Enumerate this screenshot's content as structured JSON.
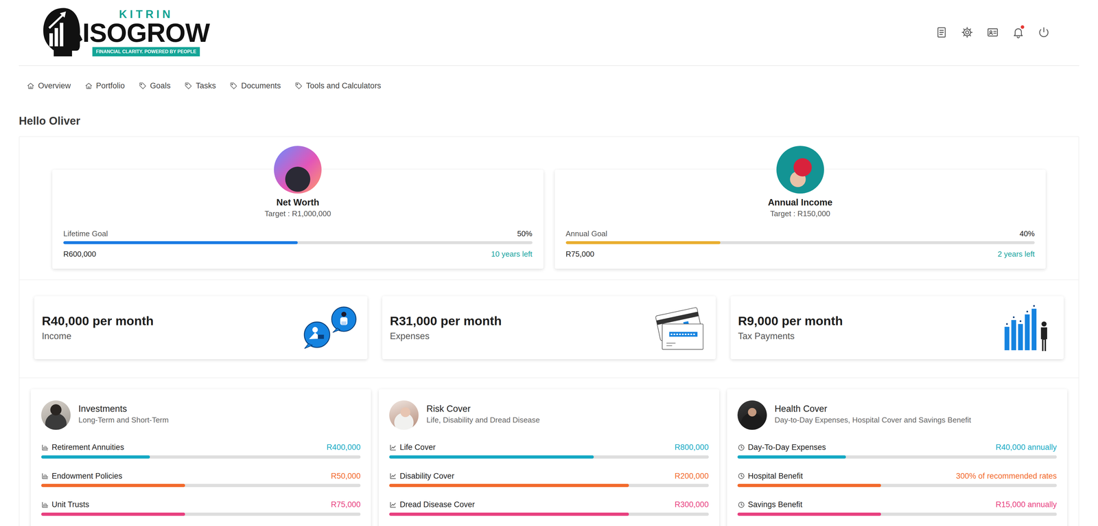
{
  "header": {
    "brand": "KITRIN",
    "name": "ISOGROW",
    "tagline": "FINANCIAL CLARITY. POWERED BY PEOPLE",
    "notifications_unread": true
  },
  "nav": [
    {
      "label": "Overview",
      "kind": "home"
    },
    {
      "label": "Portfolio",
      "kind": "home"
    },
    {
      "label": "Goals",
      "kind": "tag"
    },
    {
      "label": "Tasks",
      "kind": "tag"
    },
    {
      "label": "Documents",
      "kind": "tag"
    },
    {
      "label": "Tools and Calculators",
      "kind": "tag"
    }
  ],
  "greeting": "Hello Oliver",
  "goals": [
    {
      "title": "Net Worth",
      "target": "Target : R1,000,000",
      "goal_label": "Lifetime Goal",
      "percent": "50%",
      "level": 0.5,
      "value": "R600,000",
      "remaining": "10 years left",
      "color": "#1a7be3"
    },
    {
      "title": "Annual Income",
      "target": "Target : R150,000",
      "goal_label": "Annual Goal",
      "percent": "40%",
      "level": 0.33,
      "value": "R75,000",
      "remaining": "2 years left",
      "color": "#e9ae2f"
    }
  ],
  "summary": [
    {
      "amount": "R40,000 per month",
      "label": "Income",
      "kind": "people"
    },
    {
      "amount": "R31,000 per month",
      "label": "Expenses",
      "kind": "cards"
    },
    {
      "amount": "R9,000 per month",
      "label": "Tax Payments",
      "kind": "chart"
    }
  ],
  "categories": [
    {
      "title": "Investments",
      "subtitle": "Long-Term and Short-Term",
      "kind": "bars",
      "rows": [
        {
          "label": "Retirement Annuities",
          "value": "R400,000",
          "level": 0.34,
          "color": "#16a9c4"
        },
        {
          "label": "Endowment Policies",
          "value": "R50,000",
          "level": 0.45,
          "color": "#f2692b"
        },
        {
          "label": "Unit Trusts",
          "value": "R75,000",
          "level": 0.45,
          "color": "#e8407f"
        }
      ]
    },
    {
      "title": "Risk Cover",
      "subtitle": "Life, Disability and Dread Disease",
      "kind": "trend",
      "rows": [
        {
          "label": "Life Cover",
          "value": "R800,000",
          "level": 0.64,
          "color": "#16a9c4"
        },
        {
          "label": "Disability Cover",
          "value": "R200,000",
          "level": 0.75,
          "color": "#f2692b"
        },
        {
          "label": "Dread Disease Cover",
          "value": "R300,000",
          "level": 0.75,
          "color": "#e8407f"
        }
      ]
    },
    {
      "title": "Health Cover",
      "subtitle": "Day-to-Day Expenses, Hospital Cover and Savings Benefit",
      "kind": "clock",
      "rows": [
        {
          "label": "Day-To-Day Expenses",
          "value": "R40,000 annually",
          "level": 0.34,
          "color": "#16a9c4"
        },
        {
          "label": "Hospital Benefit",
          "value": "300% of recommended rates",
          "level": 0.45,
          "color": "#f2692b"
        },
        {
          "label": "Savings Benefit",
          "value": "R15,000 annually",
          "level": 0.45,
          "color": "#e8407f"
        }
      ]
    }
  ]
}
